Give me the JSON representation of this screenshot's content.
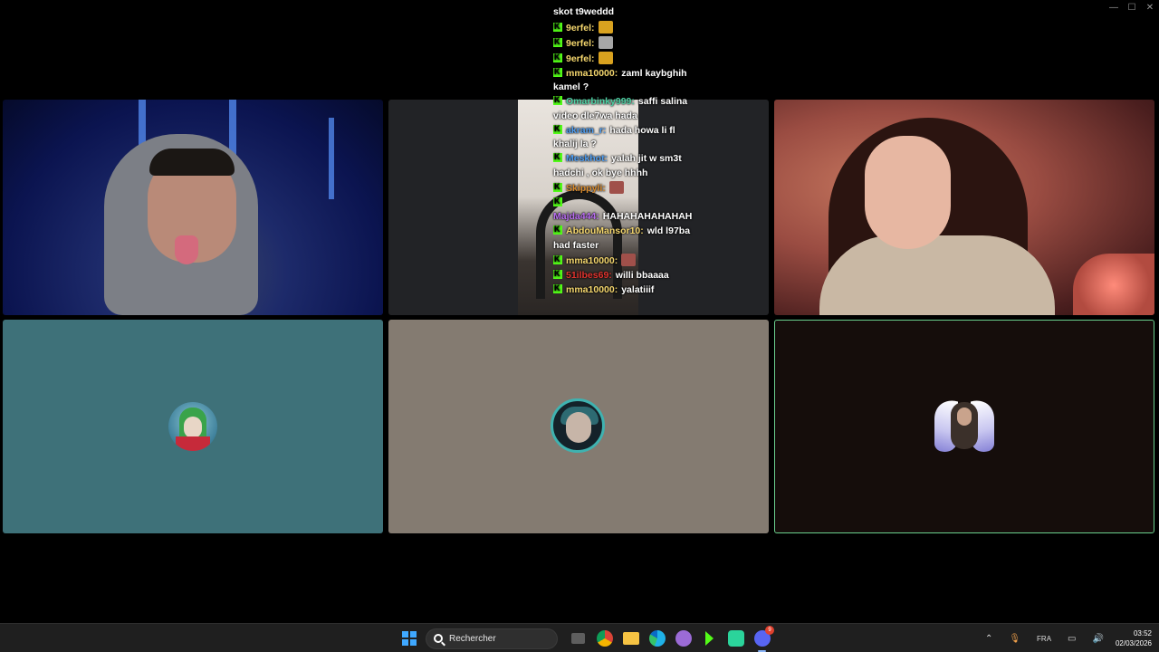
{
  "window_controls": {
    "minimize": "—",
    "maximize": "☐",
    "close": "✕"
  },
  "chat": {
    "top_line": "skot t9weddd",
    "messages": [
      {
        "user": "9erfel:",
        "text": "",
        "user_color": "#f5d76e",
        "emote": "crown-emote",
        "emote_color": "#d9a21f"
      },
      {
        "user": "9erfel:",
        "text": "",
        "user_color": "#f5d76e",
        "emote": "cat-emote",
        "emote_color": "#a6a6a6"
      },
      {
        "user": "9erfel:",
        "text": "",
        "user_color": "#f5d76e",
        "emote": "crown-emote",
        "emote_color": "#d9a21f"
      },
      {
        "user": "mma10000:",
        "text": "zaml kaybghih kamel ?",
        "user_color": "#f5d76e",
        "emote": "",
        "emote_color": ""
      },
      {
        "user": "Omarbinky999:",
        "text": "saffi salina video dle7wa hada",
        "user_color": "#4fd3a6",
        "emote": "",
        "emote_color": ""
      },
      {
        "user": "akram_r:",
        "text": "hada howa li fl khalij la ?",
        "user_color": "#4f9df0",
        "emote": "",
        "emote_color": ""
      },
      {
        "user": "Meskhot:",
        "text": "yalah jit w sm3t hadchi , ok bye hhhh",
        "user_color": "#4f9df0",
        "emote": "",
        "emote_color": ""
      },
      {
        "user": "Skippyli:",
        "text": "",
        "user_color": "#d98a2b",
        "emote": "face-emote",
        "emote_color": "#a0504a"
      },
      {
        "user": "Majda444:",
        "text": "HAHAHAHAHAHAH",
        "user_color": "#b86cf0",
        "emote": "",
        "emote_color": ""
      },
      {
        "user": "AbdouMansor10:",
        "text": "wld l97ba had faster",
        "user_color": "#f5d76e",
        "emote": "",
        "emote_color": ""
      },
      {
        "user": "mma10000:",
        "text": "",
        "user_color": "#f5d76e",
        "emote": "face-emote",
        "emote_color": "#a0504a"
      },
      {
        "user": "51ilbes69:",
        "text": "willi bbaaaa",
        "user_color": "#e0342f",
        "emote": "",
        "emote_color": ""
      },
      {
        "user": "mma10000:",
        "text": "yalatiiif",
        "user_color": "#f5d76e",
        "emote": "",
        "emote_color": ""
      }
    ]
  },
  "tiles": {
    "speaking_border_color": "#6ad08e",
    "tile4_bg": "#3e7179",
    "tile5_bg": "#847b71",
    "tile6_bg": "#150d0b"
  },
  "taskbar": {
    "search_placeholder": "Rechercher",
    "apps": [
      "task-view-icon",
      "chrome-icon",
      "file-explorer-icon",
      "edge-icon",
      "twitch-app-icon",
      "kick-app-icon",
      "android-app-icon",
      "discord-icon"
    ],
    "discord_badge": "9",
    "language": "FRA",
    "time": "03:52",
    "date": "02/03/2026"
  }
}
